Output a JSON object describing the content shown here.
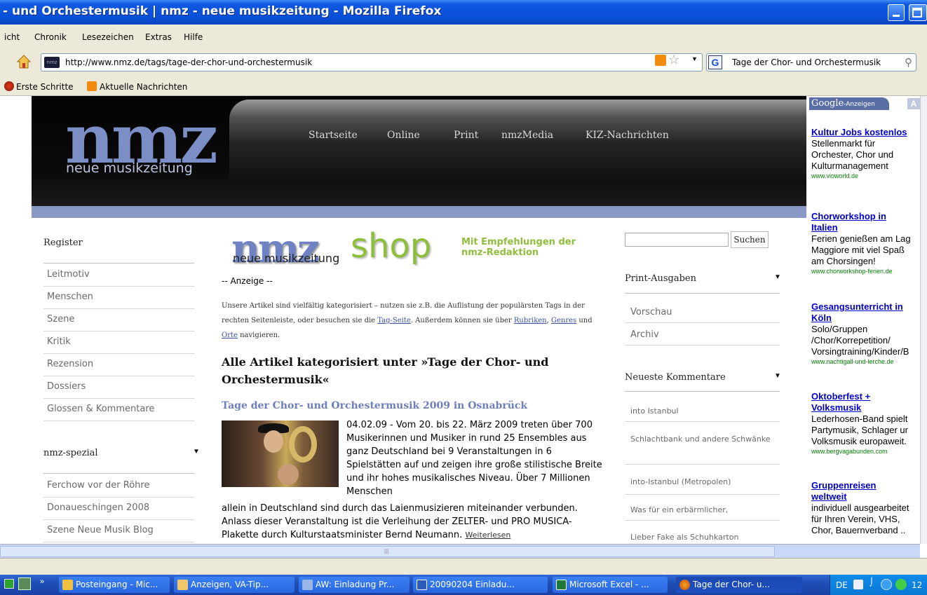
{
  "window": {
    "title": "- und Orchestermusik | nmz - neue musikzeitung - Mozilla Firefox"
  },
  "menubar": [
    "icht",
    "Chronik",
    "Lesezeichen",
    "Extras",
    "Hilfe"
  ],
  "navbar": {
    "url": "http://www.nmz.de/tags/tage-der-chor-und-orchestermusik",
    "search_text": "Tage der Chor- und Orchestermusik",
    "favicon_text": "nmz"
  },
  "bookmarks": [
    "Erste Schritte",
    "Aktuelle Nachrichten"
  ],
  "site": {
    "logo": "nmz",
    "logo_sub": "neue musikzeitung",
    "nav": [
      "Startseite",
      "Online",
      "Print",
      "nmzMedia",
      "KIZ-Nachrichten"
    ]
  },
  "sidebar": {
    "register_title": "Register",
    "register_items": [
      "Leitmotiv",
      "Menschen",
      "Szene",
      "Kritik",
      "Rezension",
      "Dossiers",
      "Glossen & Kommentare"
    ],
    "spezial_title": "nmz-spezial",
    "spezial_items": [
      "Ferchow vor der Röhre",
      "Donaueschingen 2008",
      "Szene Neue Musik Blog"
    ]
  },
  "shop": {
    "nmz": "nmz",
    "sub": "neue musikzeitung",
    "word": "shop",
    "tagline_1": "Mit Empfehlungen der",
    "tagline_2": "nmz-Redaktion"
  },
  "main": {
    "anzeige": "-- Anzeige --",
    "intro_1": "Unsere Artikel sind vielfältig kategorisiert – nutzen sie z.B. die Auflistung der populärsten Tags in der rechten Seitenleiste, oder besuchen sie die ",
    "intro_link_tagseite": "Tag-Seite",
    "intro_2": ". Außerdem können sie über ",
    "intro_link_rubriken": "Rubriken",
    "intro_3": ", ",
    "intro_link_genres": "Genres",
    "intro_4": " und ",
    "intro_link_orte": "Orte",
    "intro_5": " navigieren.",
    "heading": "Alle Artikel kategorisiert unter »Tage der Chor- und Orchestermusik«",
    "article_title": "Tage der Chor- und Orchestermusik 2009 in Osnabrück",
    "article_text_a": "04.02.09 - Vom 20. bis 22. März 2009 treten über 700 Musikerinnen und Musiker in rund 25 Ensembles aus ganz Deutschland bei 9 Veranstaltungen in 6 Spielstätten auf und zeigen ihre große stilistische Breite und ihr hohes musikalisches Niveau. Über 7 Millionen Menschen",
    "article_text_b": "allein in Deutschland sind durch das Laienmusizieren miteinander verbunden. Anlass dieser Veranstaltung ist die Verleihung der ZELTER- und PRO MUSICA-Plakette durch Kulturstaatsminister Bernd Neumann. ",
    "read_more": "Weiterlesen"
  },
  "right": {
    "search_button": "Suchen",
    "print_title": "Print-Ausgaben",
    "print_items": [
      "Vorschau",
      "Archiv"
    ],
    "comments_title": "Neueste Kommentare",
    "comments": [
      "into Istanbul",
      "Schlachtbank und andere Schwänke",
      "into-Istanbul (Metropolen)",
      "Was für ein erbärmlicher,",
      "Lieber Fake als Schuhkarton"
    ]
  },
  "ads": {
    "header_brand": "Google",
    "header_label": "-Anzeigen",
    "items": [
      {
        "title_1": "Kultur Jobs kostenlos",
        "title_2": "",
        "desc": [
          "Stellenmarkt für",
          "Orchester, Chor und",
          "Kulturmanagement"
        ],
        "url": "www.vioworld.de"
      },
      {
        "title_1": "Chorworkshop in",
        "title_2": "Italien",
        "desc": [
          "Ferien genießen am Lag",
          "Maggiore mit viel Spaß",
          "am Chorsingen!"
        ],
        "url": "www.chorworkshop-ferien.de"
      },
      {
        "title_1": "Gesangsunterricht in",
        "title_2": "Köln",
        "desc": [
          "Solo/Gruppen",
          "/Chor/Korrepetition/",
          "Vorsingtraining/Kinder/B"
        ],
        "url": "www.nachtigall-und-lerche.de"
      },
      {
        "title_1": "Oktoberfest +",
        "title_2": "Volksmusik",
        "desc": [
          "Lederhosen-Band spielt",
          "Partymusik, Schlager ur",
          "Volksmusik europaweit."
        ],
        "url": "www.bergvagabunden.com"
      },
      {
        "title_1": "Gruppenreisen",
        "title_2": "weltweit",
        "desc": [
          "individuell ausgearbeitet",
          "für Ihren Verein, VHS,",
          "Chor, Bauernverband .."
        ],
        "url": ""
      }
    ]
  },
  "taskbar": {
    "tasks": [
      "Posteingang - Mic...",
      "Anzeigen, VA-Tip...",
      "AW: Einladung Pr...",
      "20090204 Einladu...",
      "Microsoft Excel - ...",
      "Tage der Chor- u..."
    ],
    "tray_lang": "DE",
    "tray_clock": "12"
  },
  "colors": {
    "titlebar": "#0a4fd8",
    "brand_blue": "#7b8fc6",
    "shop_green": "#8cbf3a",
    "link_blue": "#0000cc",
    "ad_url_green": "#008000"
  }
}
